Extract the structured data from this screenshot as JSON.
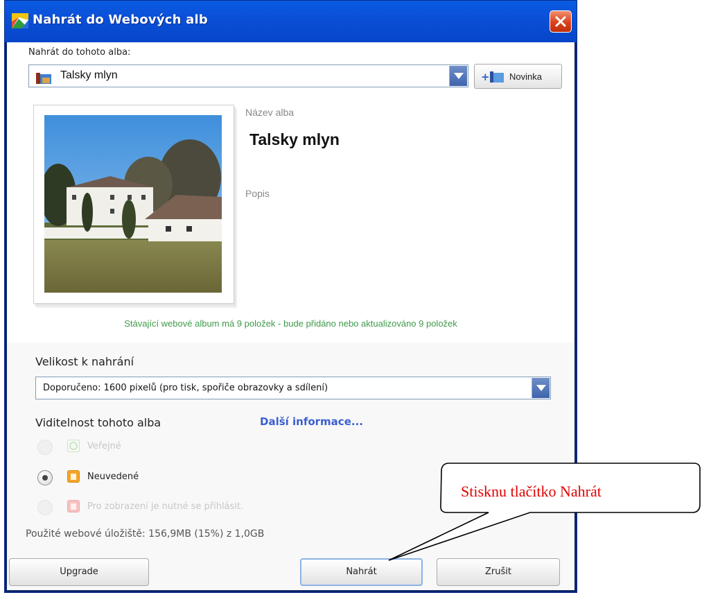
{
  "window": {
    "title": "Nahrát do Webových alb"
  },
  "album": {
    "upload_label": "Nahrát do tohoto alba:",
    "selected": "Talsky mlyn",
    "new_label": "Novinka",
    "name_label": "Název alba",
    "name_value": "Talsky mlyn",
    "description_label": "Popis",
    "info_text": "Stávající webové album má 9 položek - bude přidáno nebo aktualizováno 9 položek"
  },
  "upload_size": {
    "label": "Velikost k nahrání",
    "selected": "Doporučeno: 1600 pixelů (pro tisk, spořiče obrazovky a sdílení)"
  },
  "visibility": {
    "label": "Viditelnost tohoto alba",
    "more_info": "Další informace...",
    "options": [
      {
        "label": "Veřejné",
        "enabled": false,
        "selected": false,
        "icon": "globe-icon"
      },
      {
        "label": "Neuvedené",
        "enabled": true,
        "selected": true,
        "icon": "unlisted-lock-icon"
      },
      {
        "label": "Pro zobrazení je nutné se přihlásit.",
        "enabled": false,
        "selected": false,
        "icon": "signin-lock-icon"
      }
    ]
  },
  "storage": {
    "text": "Použité webové úložiště: 156,9MB (15%) z 1,0GB"
  },
  "buttons": {
    "upgrade": "Upgrade",
    "upload": "Nahrát",
    "cancel": "Zrušit"
  },
  "annotation": {
    "text": "Stisknu tlačítko Nahrát"
  },
  "colors": {
    "titlebar": "#0a4fd6",
    "info_text": "#3f9a4a",
    "link": "#3a5fd0",
    "annotation": "#e00000"
  }
}
